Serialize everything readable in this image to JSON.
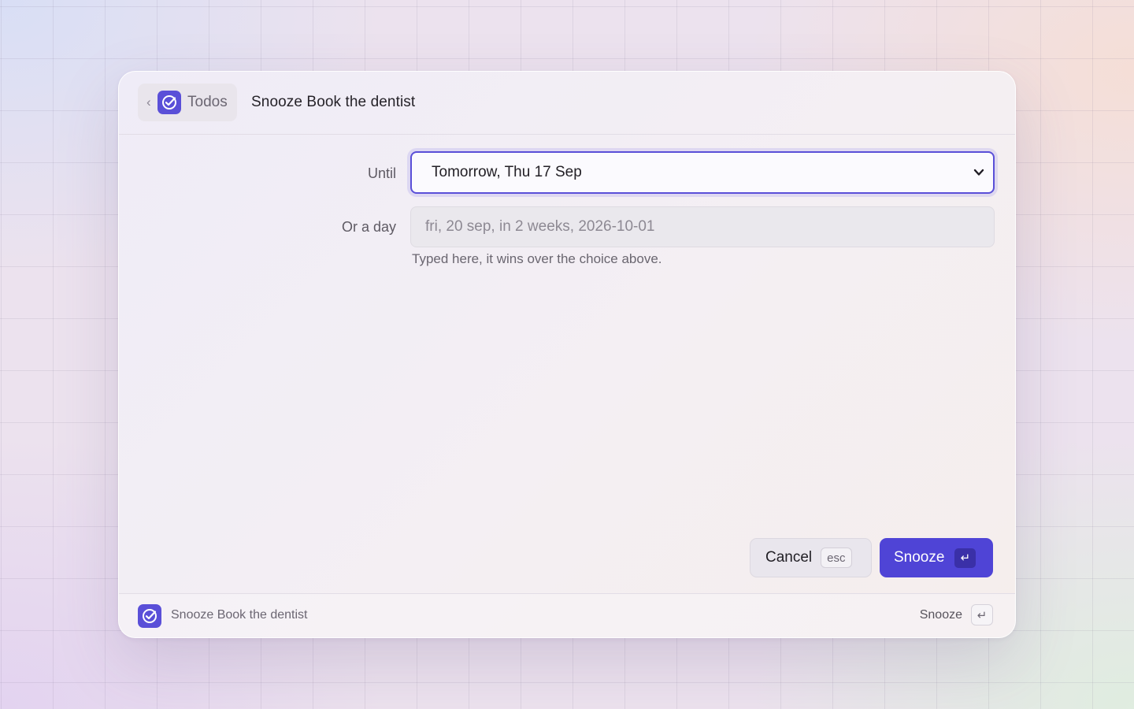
{
  "header": {
    "back_label": "Todos",
    "title": "Snooze Book the dentist"
  },
  "form": {
    "until_label": "Until",
    "until_selected": "Tomorrow, Thu 17 Sep",
    "day_label": "Or a day",
    "day_value": "",
    "day_placeholder": "fri, 20 sep, in 2 weeks, 2026-10-01",
    "day_hint": "Typed here, it wins over the choice above."
  },
  "actions": {
    "cancel_label": "Cancel",
    "cancel_shortcut": "esc",
    "snooze_label": "Snooze",
    "snooze_shortcut": "↵"
  },
  "footer": {
    "title": "Snooze Book the dentist",
    "action_label": "Snooze",
    "action_shortcut": "↵"
  },
  "icons": {
    "app": "todo-check-icon",
    "back": "chevron-left-icon",
    "select_caret": "chevron-down-icon"
  },
  "colors": {
    "accent": "#4f44d6",
    "app_icon": "#5a4fd8"
  }
}
